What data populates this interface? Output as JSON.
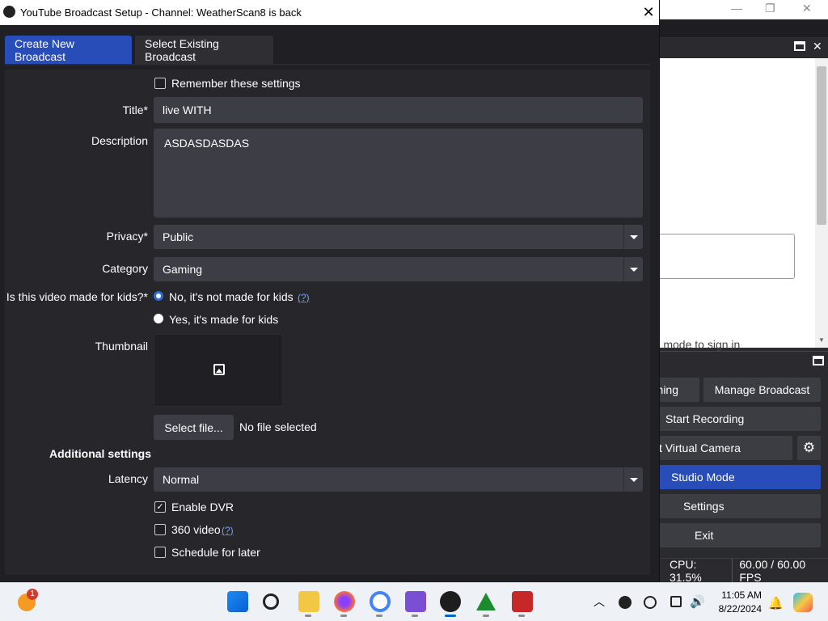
{
  "dialog": {
    "title": "YouTube Broadcast Setup - Channel: WeatherScan8 is back",
    "close_glyph": "✕",
    "tabs": [
      {
        "label": "Create New Broadcast",
        "active": true
      },
      {
        "label": "Select Existing Broadcast",
        "active": false
      }
    ],
    "form": {
      "remember_label": "Remember these settings",
      "remember_checked": false,
      "title_label": "Title*",
      "title_value": "live WITH",
      "description_label": "Description",
      "description_value": "ASDASDASDAS",
      "privacy_label": "Privacy*",
      "privacy_value": "Public",
      "category_label": "Category",
      "category_value": "Gaming",
      "kids_label": "Is this video made for kids?*",
      "kids_options": [
        {
          "label": "No, it's not made for kids",
          "selected": true
        },
        {
          "label": "Yes, it's made for kids",
          "selected": false
        }
      ],
      "help_link": "(?)",
      "thumbnail_label": "Thumbnail",
      "thumbnail_icon": "image-icon",
      "select_file_label": "Select file...",
      "no_file_text": "No file selected",
      "additional_heading": "Additional settings",
      "latency_label": "Latency",
      "latency_value": "Normal",
      "enable_dvr_label": "Enable DVR",
      "enable_dvr_checked": true,
      "video360_label": "360 video",
      "video360_checked": false,
      "schedule_label": "Schedule for later",
      "schedule_checked": false
    }
  },
  "obs": {
    "window_controls": {
      "minimize": "—",
      "maximize": "❐",
      "close": "✕"
    },
    "browser_hint": "uest mode to sign in",
    "controls": {
      "streaming_partial": "ning",
      "manage_broadcast": "Manage Broadcast",
      "start_recording": "Start Recording",
      "virtual_camera_partial": "t Virtual Camera",
      "studio_mode": "Studio Mode",
      "settings": "Settings",
      "exit": "Exit"
    },
    "status": {
      "cpu": "CPU: 31.5%",
      "fps": "60.00 / 60.00 FPS"
    }
  },
  "taskbar": {
    "notification_badge": "1",
    "apps": [
      "start-icon",
      "search-icon",
      "file-explorer-icon",
      "firefox-icon",
      "chrome-icon",
      "visual-studio-preview-icon",
      "obs-icon",
      "vectorworks-icon",
      "app-icon"
    ],
    "time": "11:05 AM",
    "date": "8/22/2024"
  },
  "colors": {
    "accent": "#284cb8",
    "dialog_bg": "#1f1f24",
    "field_bg": "#3c3d45",
    "link": "#6fa1ff"
  }
}
